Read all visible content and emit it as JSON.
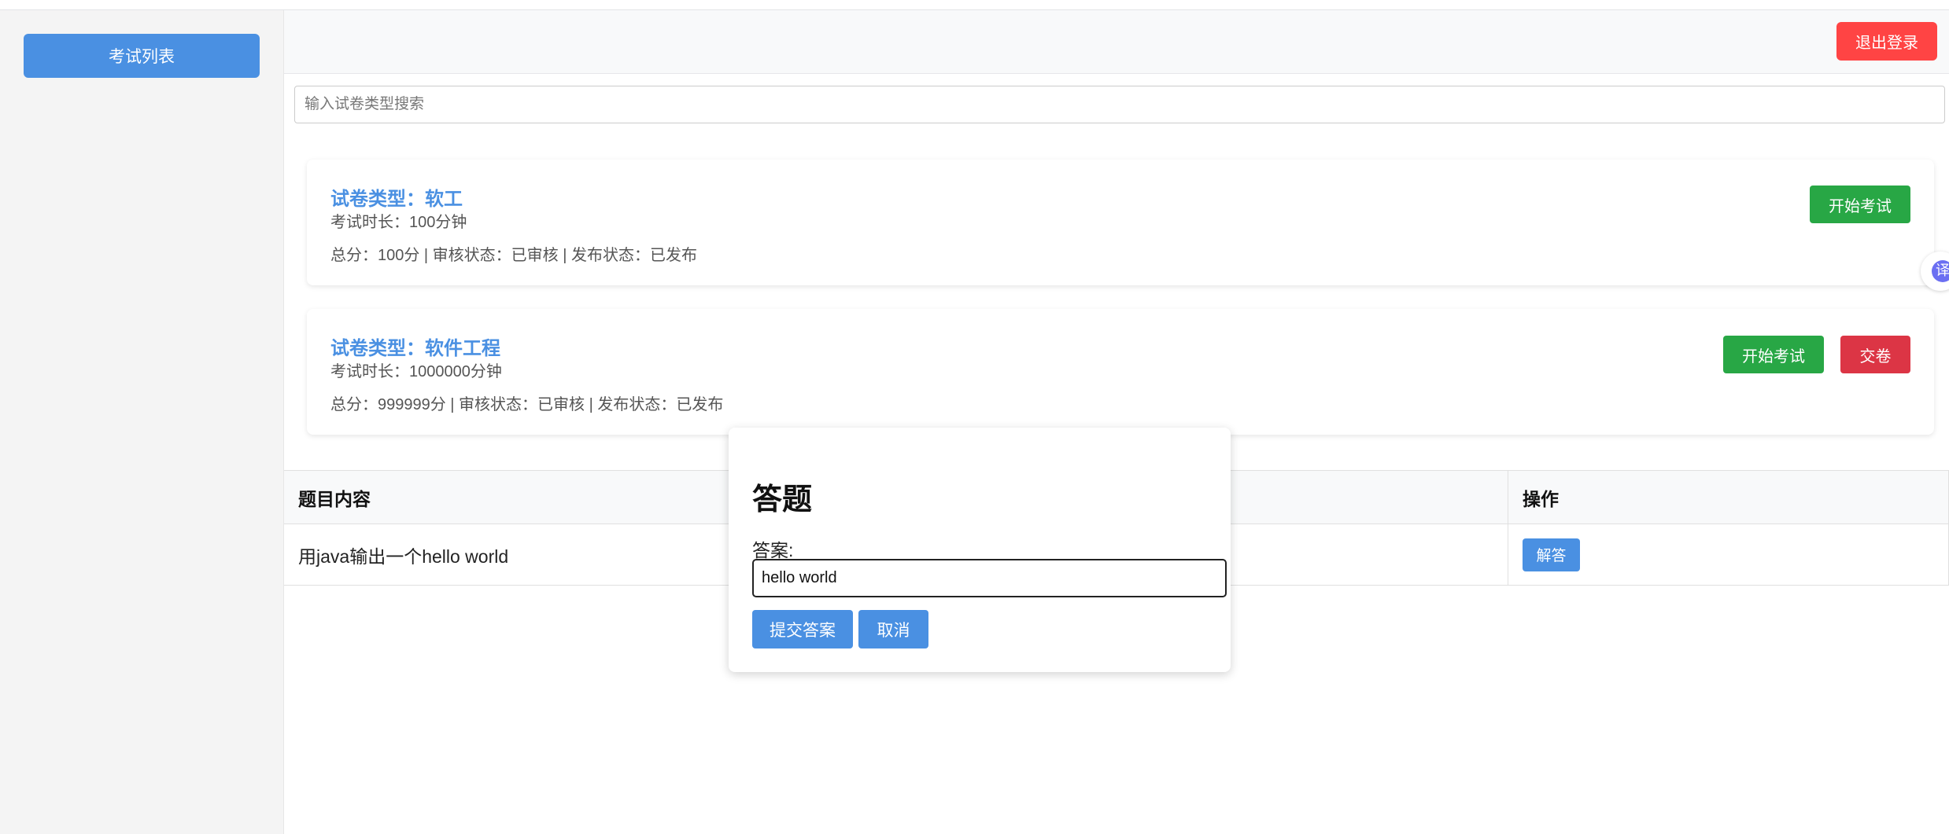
{
  "sidebar": {
    "items": [
      {
        "label": "考试列表"
      }
    ]
  },
  "header": {
    "logout_label": "退出登录"
  },
  "search": {
    "placeholder": "输入试卷类型搜索"
  },
  "exams": [
    {
      "title": "试卷类型：软工",
      "duration": "考试时长：100分钟",
      "meta": "总分：100分 | 审核状态：已审核 | 发布状态：已发布",
      "start_label": "开始考试"
    },
    {
      "title": "试卷类型：软件工程",
      "duration": "考试时长：1000000分钟",
      "meta": "总分：999999分 | 审核状态：已审核 | 发布状态：已发布",
      "start_label": "开始考试",
      "submit_label": "交卷"
    }
  ],
  "table": {
    "headers": [
      "题目内容",
      "操作"
    ],
    "rows": [
      {
        "content": "用java输出一个hello world",
        "action_label": "解答"
      }
    ]
  },
  "modal": {
    "title": "答题",
    "answer_label": "答案:",
    "answer_value": "hello world",
    "submit_label": "提交答案",
    "cancel_label": "取消"
  },
  "translate_widget": {
    "glyph": "译"
  },
  "colors": {
    "primary": "#4a90e2",
    "success": "#28a745",
    "danger": "#dc3545",
    "logout": "#ff4444"
  }
}
